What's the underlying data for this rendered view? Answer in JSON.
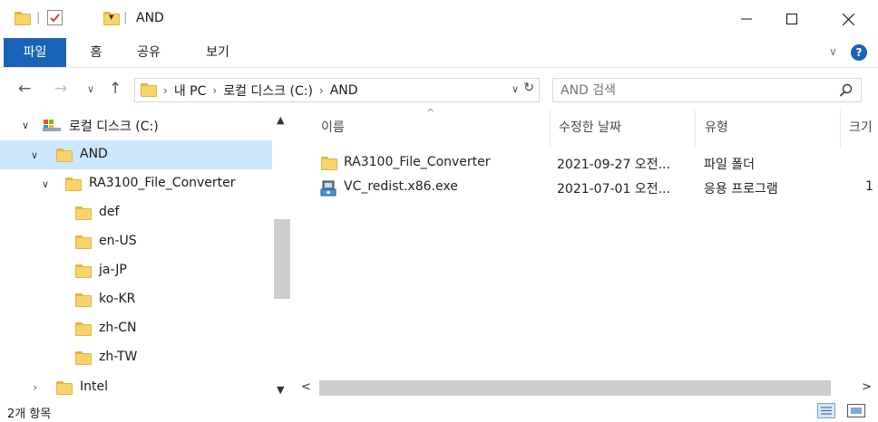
{
  "window": {
    "title": "AND"
  },
  "ribbon": {
    "tabs": [
      "파일",
      "홈",
      "공유",
      "보기"
    ]
  },
  "address": {
    "path": [
      "내 PC",
      "로컬 디스크 (C:)",
      "AND"
    ]
  },
  "search": {
    "placeholder": "AND 검색"
  },
  "tree": {
    "items": [
      {
        "label": "로컬 디스크 (C:)",
        "expanded": true,
        "selected": false
      },
      {
        "label": "AND",
        "expanded": true,
        "selected": true
      },
      {
        "label": "RA3100_File_Converter",
        "expanded": true,
        "selected": false
      },
      {
        "label": "def"
      },
      {
        "label": "en-US"
      },
      {
        "label": "ja-JP"
      },
      {
        "label": "ko-KR"
      },
      {
        "label": "zh-CN"
      },
      {
        "label": "zh-TW"
      },
      {
        "label": "Intel",
        "expanded": false
      }
    ]
  },
  "list": {
    "columns": [
      "이름",
      "수정한 날짜",
      "유형",
      "크기"
    ],
    "rows": [
      {
        "name": "RA3100_File_Converter",
        "date": "2021-09-27 오전...",
        "type": "파일 폴더",
        "size": "",
        "icon": "folder-icon"
      },
      {
        "name": "VC_redist.x86.exe",
        "date": "2021-07-01 오전...",
        "type": "응용 프로그램",
        "size": "1",
        "icon": "installer-icon"
      }
    ]
  },
  "status": {
    "count": "2개 항목"
  },
  "colors": {
    "accent": "#1a64b8",
    "selection": "#cce8ff",
    "folder": "#f8d26b"
  }
}
